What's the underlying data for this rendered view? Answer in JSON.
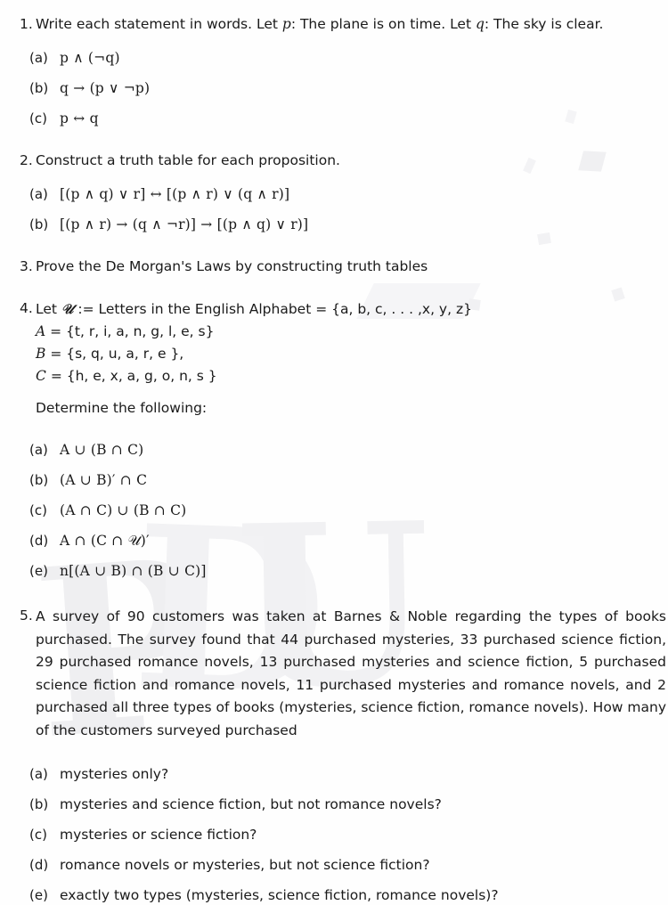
{
  "page": {
    "background": "#fefefe",
    "ink": "#1a1a1a",
    "watermark_color": "#efeff1",
    "watermark_glyphs": [
      "P",
      "D",
      "U"
    ]
  },
  "problems": [
    {
      "number": "1.",
      "stem": "Write each statement in words. Let p: The plane is on time. Let q: The sky is clear.",
      "stem_parts": {
        "lead": "Write each statement in words. Let ",
        "var1": "p",
        "mid": ": The plane is on time. Let ",
        "var2": "q",
        "tail": ": The sky is clear."
      },
      "items": [
        {
          "label": "(a)",
          "text": "p ∧ (¬q)"
        },
        {
          "label": "(b)",
          "text": "q → (p ∨ ¬p)"
        },
        {
          "label": "(c)",
          "text": "p ↔ q"
        }
      ]
    },
    {
      "number": "2.",
      "stem": "Construct a truth table for each proposition.",
      "items": [
        {
          "label": "(a)",
          "text": "[(p ∧ q) ∨ r] ↔ [(p ∧ r) ∨ (q ∧ r)]"
        },
        {
          "label": "(b)",
          "text": "[(p ∧ r) → (q ∧ ¬r)] → [(p ∧ q) ∨ r)]"
        }
      ]
    },
    {
      "number": "3.",
      "stem": "Prove the De Morgan's Laws by constructing truth tables",
      "items": []
    },
    {
      "number": "4.",
      "stem": "Let 𝒰 := Letters in the English Alphabet = {a, b, c, . . . ,x, y, z}",
      "stem_parts": {
        "lead": "Let ",
        "script_u": "𝒰",
        "tail": " := Letters in the English Alphabet = {a, b, c, . . . ,x, y, z}"
      },
      "set_definitions": [
        {
          "name": "A",
          "value": "= {t, r, i, a, n, g, l, e, s}"
        },
        {
          "name": "B",
          "value": "= {s, q, u, a, r, e },"
        },
        {
          "name": "C",
          "value": "= {h, e, x, a, g, o, n, s }"
        }
      ],
      "instruction": "Determine the following:",
      "items": [
        {
          "label": "(a)",
          "text": "A ∪ (B ∩ C)"
        },
        {
          "label": "(b)",
          "text": "(A ∪ B)′ ∩ C"
        },
        {
          "label": "(c)",
          "text": "(A ∩ C) ∪ (B ∩ C)"
        },
        {
          "label": "(d)",
          "text": "A ∩ (C ∩ 𝒰)′"
        },
        {
          "label": "(e)",
          "text": "n[(A ∪ B) ∩ (B ∪ C)]"
        }
      ]
    },
    {
      "number": "5.",
      "stem": "A survey of 90 customers was taken at Barnes & Noble regarding the types of books purchased. The survey found that 44 purchased mysteries, 33 purchased science fiction, 29 purchased romance novels, 13 purchased mysteries and science fiction, 5 purchased science fiction and romance novels, 11 purchased mysteries and romance novels, and 2 purchased all three types of books (mysteries, science fiction, romance novels). How many of the customers surveyed purchased",
      "survey_values": {
        "total_customers": 90,
        "store": "Barnes & Noble",
        "mysteries": 44,
        "science_fiction": 33,
        "romance_novels": 29,
        "mysteries_and_science_fiction": 13,
        "science_fiction_and_romance": 5,
        "mysteries_and_romance": 11,
        "all_three": 2
      },
      "items": [
        {
          "label": "(a)",
          "text": "mysteries only?"
        },
        {
          "label": "(b)",
          "text": "mysteries and science fiction, but not romance novels?"
        },
        {
          "label": "(c)",
          "text": "mysteries or science fiction?"
        },
        {
          "label": "(d)",
          "text": "romance novels or mysteries, but not science fiction?"
        },
        {
          "label": "(e)",
          "text": "exactly two types (mysteries, science fiction, romance novels)?"
        }
      ]
    }
  ]
}
